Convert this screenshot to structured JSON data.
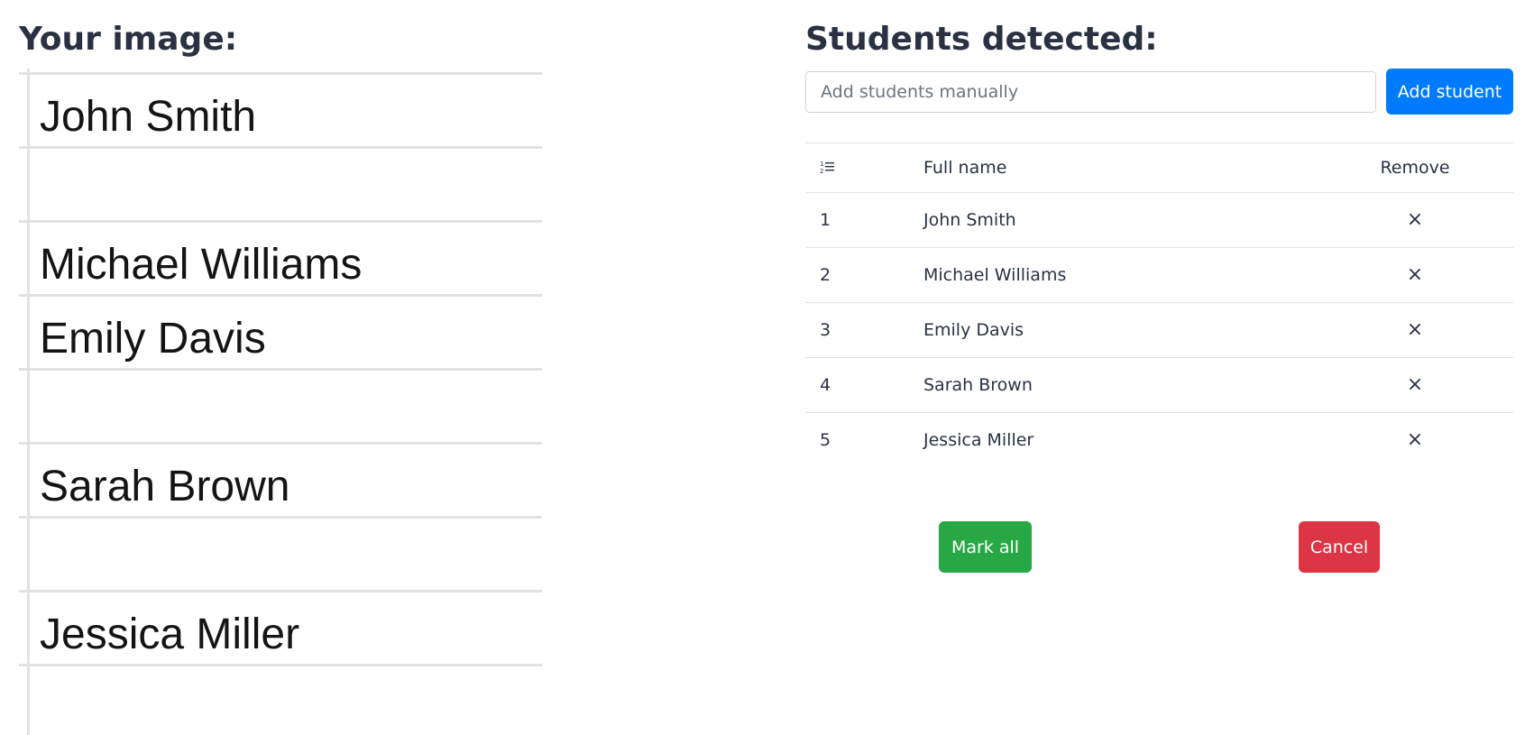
{
  "left_panel": {
    "heading": "Your image:",
    "handwritten_names": [
      "John Smith",
      "Michael Williams",
      "Emily Davis",
      "Sarah Brown",
      "Jessica Miller"
    ]
  },
  "right_panel": {
    "heading": "Students detected:",
    "add_input": {
      "value": "",
      "placeholder": "Add students manually"
    },
    "add_button": "Add student",
    "table": {
      "header_icon": "ordered-list-icon",
      "columns": {
        "number": "",
        "name": "Full name",
        "remove": "Remove"
      },
      "remove_glyph": "×",
      "rows": [
        {
          "num": "1",
          "name": "John Smith"
        },
        {
          "num": "2",
          "name": "Michael Williams"
        },
        {
          "num": "3",
          "name": "Emily Davis"
        },
        {
          "num": "4",
          "name": "Sarah Brown"
        },
        {
          "num": "5",
          "name": "Jessica Miller"
        }
      ]
    },
    "mark_all_button": "Mark all",
    "cancel_button": "Cancel"
  },
  "colors": {
    "primary": "#007bff",
    "success": "#28a745",
    "danger": "#dc3545",
    "text": "#2a3142",
    "rule": "#e2e2e2"
  }
}
